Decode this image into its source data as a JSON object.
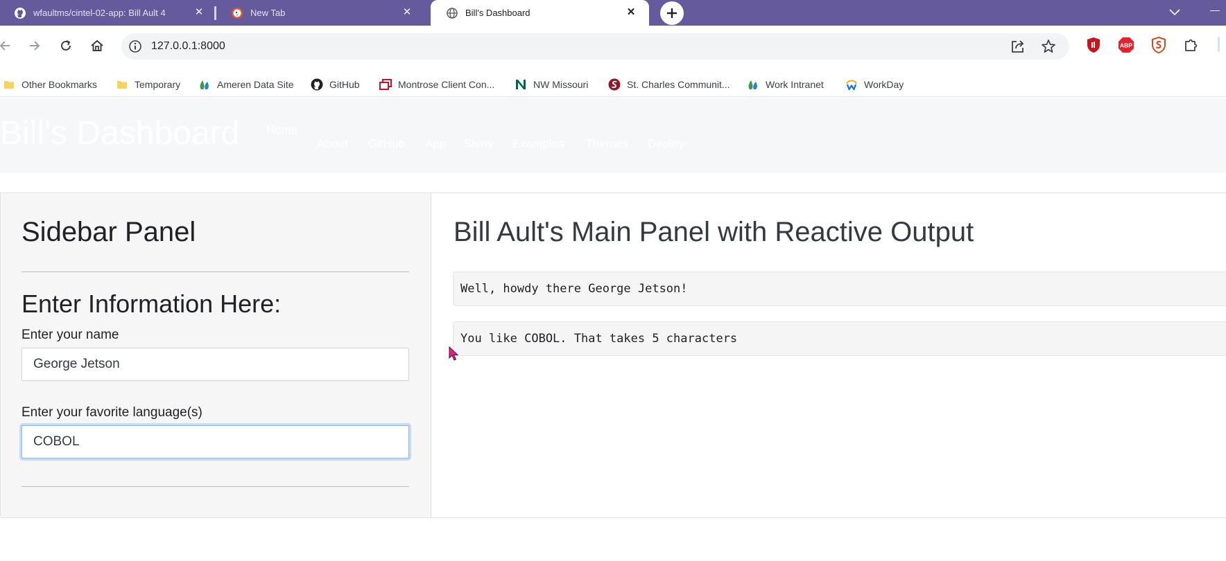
{
  "browser": {
    "tabs": [
      {
        "title": "wfaultms/cintel-02-app: Bill Ault 4",
        "icon": "github-icon",
        "active": false
      },
      {
        "title": "New Tab",
        "icon": "duckduckgo-icon",
        "active": false
      },
      {
        "title": "Bill's Dashboard",
        "icon": "globe-icon",
        "active": true
      }
    ],
    "url": "127.0.0.1:8000",
    "bookmarks": [
      {
        "label": "Other Bookmarks",
        "icon": "folder-icon"
      },
      {
        "label": "Temporary",
        "icon": "folder-icon"
      },
      {
        "label": "Ameren Data Site",
        "icon": "ameren-icon"
      },
      {
        "label": "GitHub",
        "icon": "github-icon"
      },
      {
        "label": "Montrose Client Con...",
        "icon": "montrose-icon"
      },
      {
        "label": "NW Missouri",
        "icon": "nw-missouri-icon"
      },
      {
        "label": "St. Charles Communit...",
        "icon": "st-charles-icon"
      },
      {
        "label": "Work Intranet",
        "icon": "ameren-icon"
      },
      {
        "label": "WorkDay",
        "icon": "workday-icon"
      }
    ],
    "extensions": [
      "ublock-icon",
      "adblock-plus-icon",
      "shield-extension-icon",
      "puzzle-icon"
    ],
    "colors": {
      "tabstrip": "#645a9c",
      "active_tab": "#ffffff"
    }
  },
  "navbar": {
    "brand": "Bill's Dashboard",
    "links": [
      "Home",
      "About",
      "GitHub",
      "App",
      "Shiny",
      "Examples",
      "Themes",
      "Deploy"
    ]
  },
  "sidebar": {
    "title": "Sidebar Panel",
    "subtitle": "Enter Information Here:",
    "name_label": "Enter your name",
    "name_value": "George Jetson",
    "language_label": "Enter your favorite language(s)",
    "language_value": "COBOL"
  },
  "main": {
    "title": "Bill Ault's Main Panel with Reactive Output",
    "greeting": "Well, howdy there George Jetson!",
    "language_output": "You like COBOL. That takes 5 characters"
  }
}
